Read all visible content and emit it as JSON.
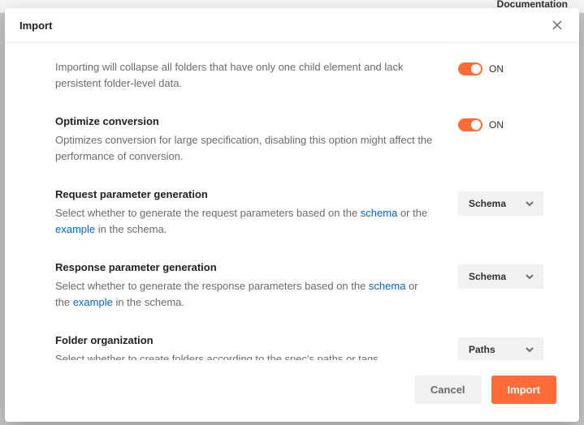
{
  "background": {
    "doc_link": "Documentation"
  },
  "modal": {
    "title": "Import",
    "options": {
      "collapse": {
        "desc_pre": "Importing will collapse all folders that have only one child element and lack persistent folder-level data.",
        "toggle_label": "ON"
      },
      "optimize": {
        "title": "Optimize conversion",
        "desc": "Optimizes conversion for large specification, disabling this option might affect the performance of conversion.",
        "toggle_label": "ON"
      },
      "req_param": {
        "title": "Request parameter generation",
        "desc_pre": "Select whether to generate the request parameters based on the ",
        "link1": "schema",
        "desc_mid": " or the ",
        "link2": "example",
        "desc_post": " in the schema.",
        "selected": "Schema"
      },
      "resp_param": {
        "title": "Response parameter generation",
        "desc_pre": "Select whether to generate the response parameters based on the ",
        "link1": "schema",
        "desc_mid": " or the ",
        "link2": "example",
        "desc_post": " in the schema.",
        "selected": "Schema"
      },
      "folder_org": {
        "title": "Folder organization",
        "desc": "Select whether to create folders according to the spec's paths or tags.",
        "selected": "Paths"
      }
    },
    "footer": {
      "cancel": "Cancel",
      "import": "Import"
    }
  }
}
